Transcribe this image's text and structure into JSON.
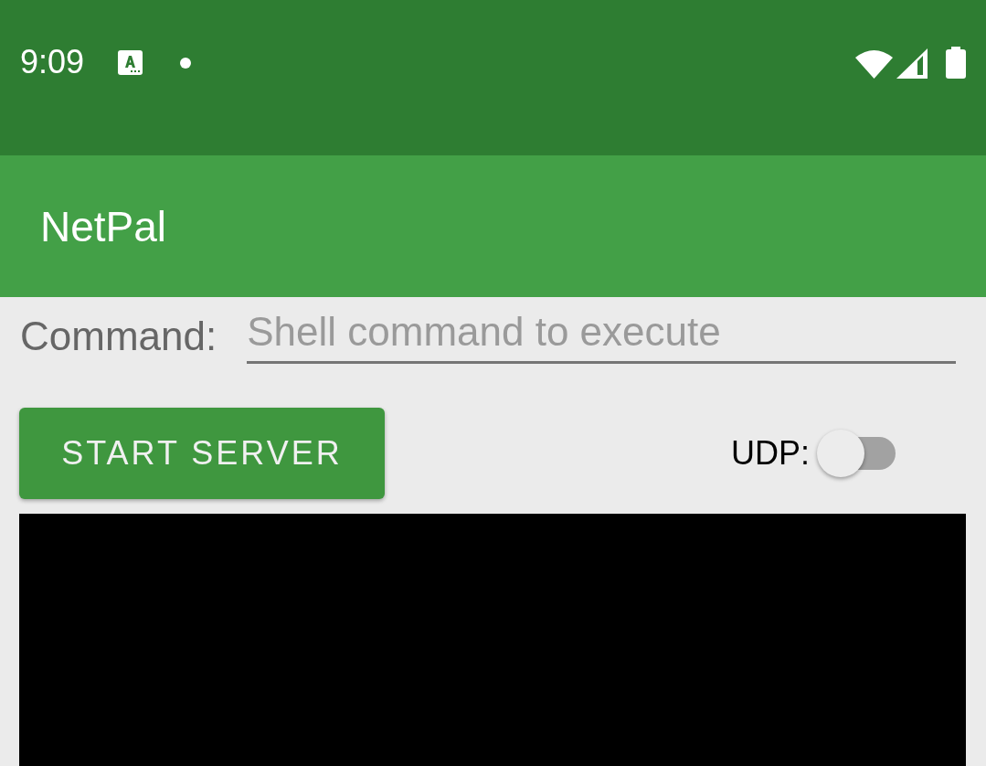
{
  "status_bar": {
    "time": "9:09"
  },
  "app_bar": {
    "title": "NetPal"
  },
  "command": {
    "label": "Command:",
    "placeholder": "Shell command to execute"
  },
  "start_button": {
    "label": "START SERVER"
  },
  "udp": {
    "label": "UDP:",
    "on": false
  }
}
